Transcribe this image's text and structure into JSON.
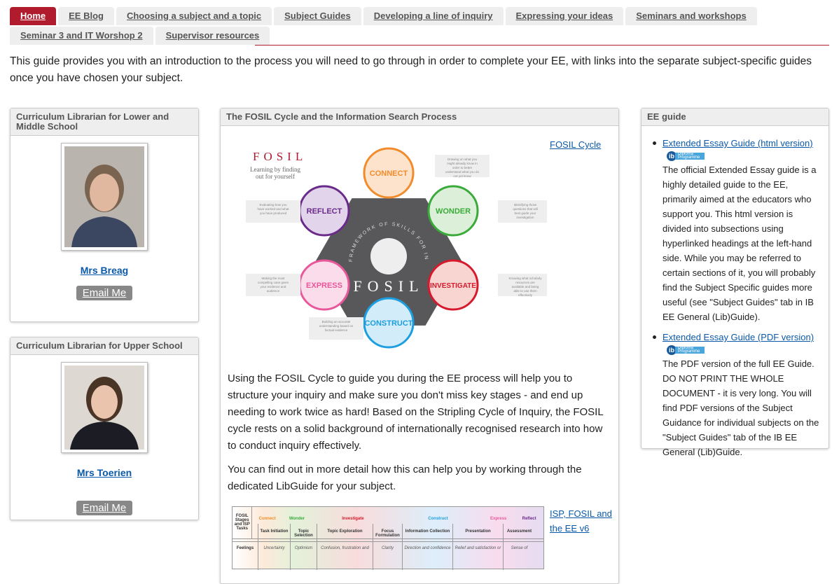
{
  "tabs": {
    "row1": [
      "Home",
      "EE Blog",
      "Choosing a subject and a topic",
      "Subject Guides",
      "Developing a line of inquiry",
      "Expressing your ideas",
      "Seminars and workshops"
    ],
    "row2": [
      "Seminar 3 and IT Worshop 2",
      "Supervisor resources"
    ],
    "active": "Home"
  },
  "intro": "This guide provides you with an introduction to the process you will need to go through in order to complete your EE, with links into the separate subject-specific guides once you have chosen your subject.",
  "librarians": [
    {
      "header": "Curriculum Librarian for Lower and Middle School",
      "name": "Mrs Breag",
      "email_label": "Email Me"
    },
    {
      "header": "Curriculum Librarian for Upper School",
      "name": "Mrs Toerien",
      "email_label": "Email Me"
    }
  ],
  "fosil_box": {
    "header": "The FOSIL Cycle and the Information Search Process",
    "link": "FOSIL Cycle",
    "diagram": {
      "title": "FOSIL",
      "tagline1": "Learning by finding",
      "tagline2": "out for yourself",
      "center": "FOSIL",
      "ring": "FRAMEWORK OF SKILLS FOR INQUIRY LEARNING",
      "stages": [
        {
          "label": "CONNECT",
          "color": "#f28b2b",
          "fill": "#fde3cc",
          "note": "Drawing on what you might already know in order to better understand what you do not yet know"
        },
        {
          "label": "WONDER",
          "color": "#3aaa3a",
          "fill": "#dcefd8",
          "note": "Identifying those questions that will best guide your investigation"
        },
        {
          "label": "INVESTIGATE",
          "color": "#d7192d",
          "fill": "#f8d5d0",
          "note": "Knowing what scholarly resources are available and being able to use them effectively"
        },
        {
          "label": "CONSTRUCT",
          "color": "#1c9ee0",
          "fill": "#d3ecfa",
          "note": "Building an accurate understanding based on factual evidence"
        },
        {
          "label": "EXPRESS",
          "color": "#e8579a",
          "fill": "#fadcea",
          "note": "Making the most compelling case given your evidence and audience"
        },
        {
          "label": "REFLECT",
          "color": "#6a2a8a",
          "fill": "#e2d4ea",
          "note": "Evaluating how you have worked and what you have produced"
        }
      ]
    },
    "para1": "Using the FOSIL Cycle to guide you during the EE process will help you to structure your inquiry and make sure you don't miss key stages - and end up needing to work twice as hard! Based on the Stripling Cycle of Inquiry, the FOSIL cycle rests on a solid background of internationally recognised research into how to conduct inquiry effectively.",
    "para2": "You can find out in more detail how this can help you by working through the dedicated LibGuide for your subject.",
    "link2": "ISP, FOSIL and the EE v6",
    "table": {
      "corner": "FOSIL Stages and ISP Tasks",
      "stages": [
        "Connect",
        "Wonder",
        "Investigate",
        "Construct",
        "Express",
        "Reflect"
      ],
      "tasks": [
        "Task Initiation",
        "Topic Selection",
        "Topic Exploration",
        "Focus Formulation",
        "Information Collection",
        "Presentation",
        "Assessment"
      ],
      "row_label": "Feelings",
      "feelings": [
        "Uncertainty",
        "Optimism",
        "Confusion, frustration and",
        "Clarity",
        "Direction and confidence",
        "Relief and satisfaction or",
        "Sense of"
      ]
    }
  },
  "ee_guide": {
    "header": "EE guide",
    "ib_badge": "Diploma Programme",
    "items": [
      {
        "link": "Extended Essay Guide (html version)",
        "text": "The official Extended Essay guide is a highly detailed guide to the EE, primarily aimed at the educators who support you. This html version is divided into subsections using hyperlinked headings at the left-hand side. While you may be referred to certain sections of it, you will probably find the Subject Specific guides more useful (see \"Subject Guides\" tab in IB EE General (Lib)Guide)."
      },
      {
        "link": "Extended Essay Guide (PDF version)",
        "text": "The PDF version of the full EE Guide. DO NOT PRINT THE WHOLE DOCUMENT - it is very long. You will find PDF versions of the Subject Guidance for individual subjects on the \"Subject Guides\" tab of the IB EE General (Lib)Guide."
      }
    ]
  }
}
